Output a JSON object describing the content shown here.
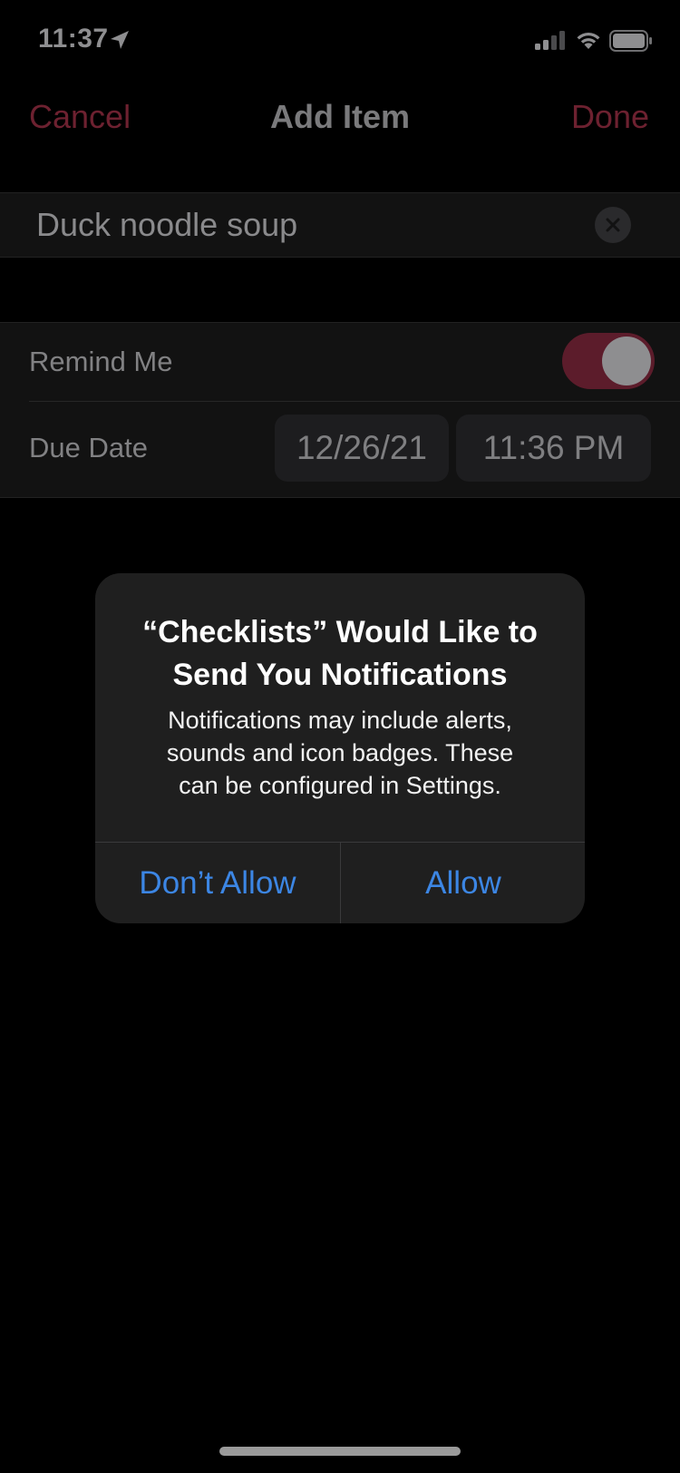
{
  "status_bar": {
    "time": "11:37"
  },
  "nav": {
    "cancel_label": "Cancel",
    "title": "Add Item",
    "done_label": "Done"
  },
  "item": {
    "text_value": "Duck noodle soup"
  },
  "settings": {
    "remind_label": "Remind Me",
    "remind_on": true,
    "due_label": "Due Date",
    "due_date": "12/26/21",
    "due_time": "11:36 PM"
  },
  "alert": {
    "title_line1": "“Checklists” Would Like to",
    "title_line2": "Send You Notifications",
    "message_line1": "Notifications may include alerts,",
    "message_line2": "sounds and icon badges. These",
    "message_line3": "can be configured in Settings.",
    "dont_allow_label": "Don’t Allow",
    "allow_label": "Allow"
  },
  "colors": {
    "accent_dimmed": "#6d2130",
    "alert_button": "#3c86e4",
    "alert_background": "#1f1f1f"
  },
  "icons": [
    "location-arrow-icon",
    "cellular-signal-icon",
    "wifi-icon",
    "battery-icon",
    "clear-text-icon"
  ]
}
